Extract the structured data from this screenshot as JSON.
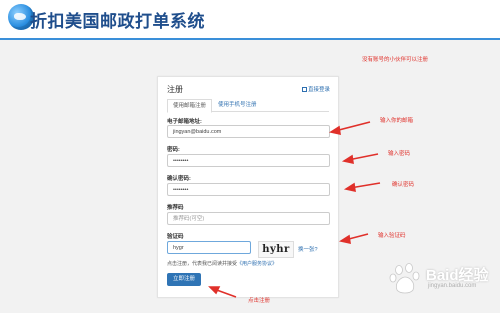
{
  "header": {
    "title": "折扣美国邮政打单系统"
  },
  "card": {
    "title": "注册",
    "login_link": "直接登录",
    "tabs": [
      "使用邮箱注册",
      "使用手机号注册"
    ],
    "fields": {
      "email": {
        "label": "电子邮箱地址:",
        "value": "jingyan@baidu.com"
      },
      "password": {
        "label": "密码:",
        "value": "••••••••"
      },
      "confirm": {
        "label": "确认密码:",
        "value": "••••••••"
      },
      "referrer": {
        "label": "推荐码",
        "placeholder": "推荐码(可空)"
      },
      "captcha": {
        "label": "验证码",
        "value": "hygr",
        "image_text": "hyhr",
        "refresh": "换一张?"
      }
    },
    "agree_text": "点击注册，代表我已阅读并接受",
    "agree_link": "《用户服务协议》",
    "submit": "立即注册"
  },
  "annotations": {
    "top_note": "没有账号的小伙伴可以注册",
    "email": "输入你的邮箱",
    "password": "输入密码",
    "confirm": "确认密码",
    "captcha": "输入验证码",
    "submit": "点击注册"
  },
  "watermark": {
    "text": "Baid经验",
    "sub": "jingyan.baidu.com"
  },
  "colors": {
    "accent": "#2f74b5",
    "annotation": "#e0302a",
    "header_line": "#3a8fd9"
  }
}
